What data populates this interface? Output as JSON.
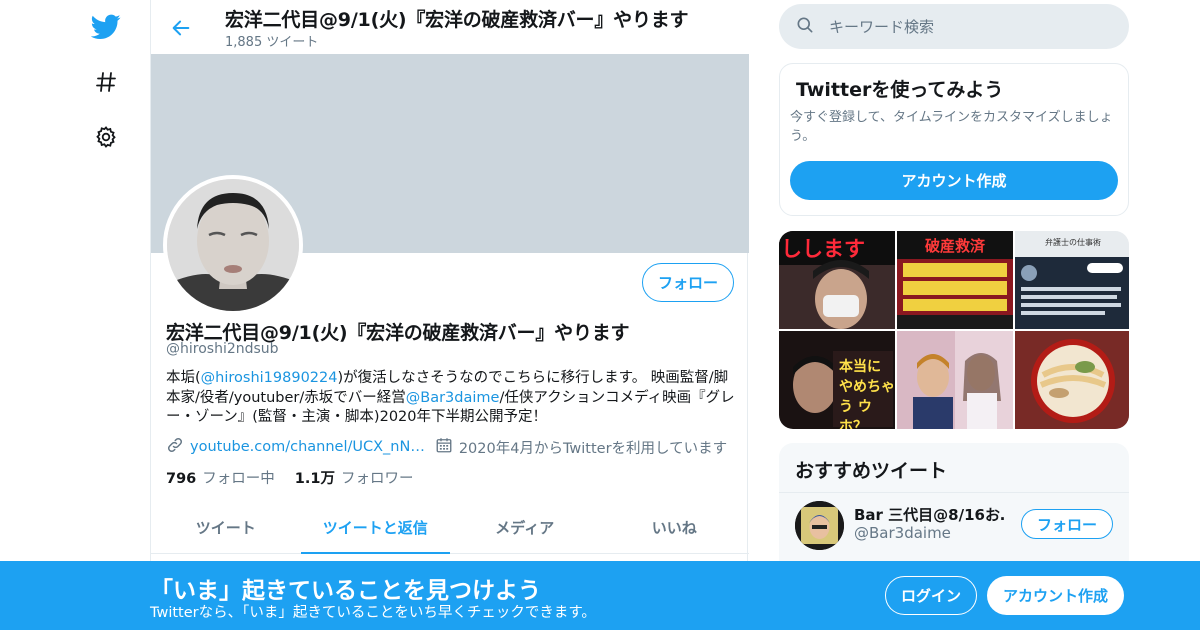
{
  "header": {
    "title": "宏洋二代目@9/1(火)『宏洋の破産救済バー』やります",
    "tweet_count": "1,885 ツイート"
  },
  "profile": {
    "display_name": "宏洋二代目@9/1(火)『宏洋の破産救済バー』やります",
    "handle": "@hiroshi2ndsub",
    "follow_label": "フォロー",
    "bio": {
      "p1": "本垢(",
      "mention1": "@hiroshi19890224",
      "p2": ")が復活しなさそうなのでこちらに移行します。 映画監督/脚本家/役者/youtuber/赤坂でバー経営",
      "mention2": "@Bar3daime",
      "p3": "/任侠アクションコメディ映画『グレー・ゾーン』(監督・主演・脚本)2020年下半期公開予定！"
    },
    "link": "youtube.com/channel/UCX_nN…",
    "joined": "2020年4月からTwitterを利用しています",
    "following_count": "796",
    "following_label": "フォロー中",
    "followers_count": "1.1万",
    "followers_label": "フォロワー"
  },
  "tabs": [
    {
      "label": "ツイート",
      "active": false
    },
    {
      "label": "ツイートと返信",
      "active": true
    },
    {
      "label": "メディア",
      "active": false
    },
    {
      "label": "いいね",
      "active": false
    }
  ],
  "search": {
    "placeholder": "キーワード検索"
  },
  "signup_card": {
    "title": "Twitterを使ってみよう",
    "description": "今すぐ登録して、タイムラインをカスタマイズしましょう。",
    "button": "アカウント作成"
  },
  "media_thumbnails": [
    {
      "caption": "しします"
    },
    {
      "caption": "破産救済"
    },
    {
      "caption": "弁護士の仕事術"
    },
    {
      "caption": "本当に やめちゃう ウホ？"
    },
    {
      "caption": ""
    },
    {
      "caption": ""
    }
  ],
  "recommended": {
    "title": "おすすめツイート",
    "account_name": "Bar 三代目@8/16お…",
    "account_handle": "@Bar3daime",
    "follow_label": "フォロー"
  },
  "bottom_bar": {
    "title": "「いま」起きていることを見つけよう",
    "subtitle": "Twitterなら、「いま」起きていることをいち早くチェックできます。",
    "login": "ログイン",
    "signup": "アカウント作成"
  },
  "colors": {
    "brand": "#1da1f2",
    "link": "#1b95e0",
    "muted": "#657786",
    "banner": "#ccd6dd"
  },
  "icons": [
    "twitter-bird-icon",
    "hashtag-icon",
    "gear-icon",
    "back-arrow-icon",
    "search-icon",
    "link-icon",
    "calendar-icon"
  ]
}
